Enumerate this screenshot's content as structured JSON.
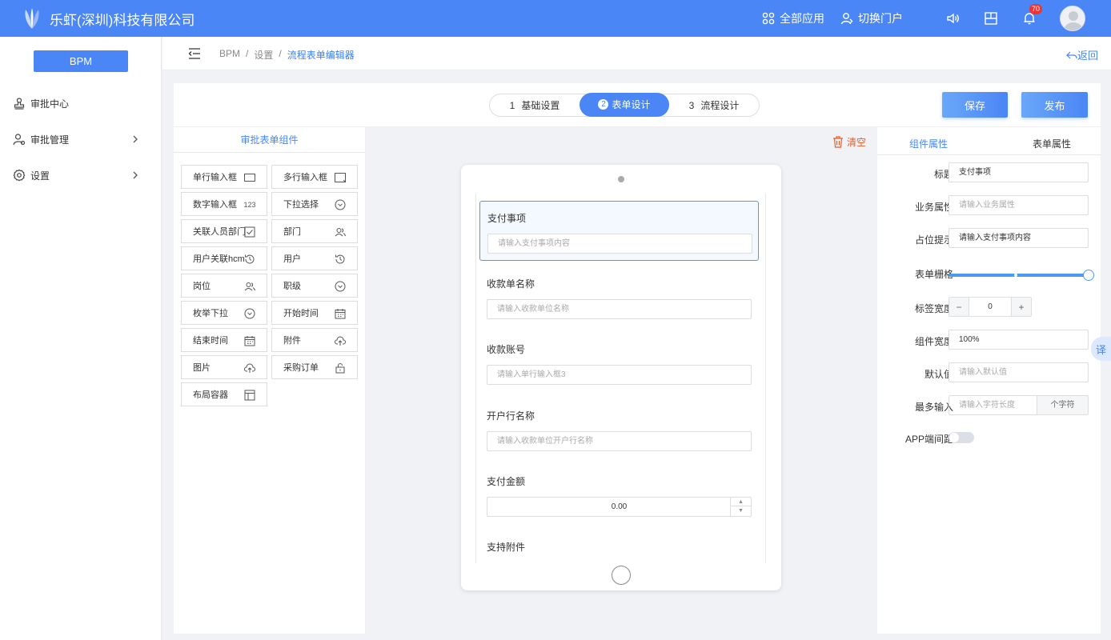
{
  "header": {
    "company": "乐虾(深圳)科技有限公司",
    "all_apps": "全部应用",
    "switch_portal": "切换门户",
    "notification_count": "70",
    "brand_color": "#4a86f5"
  },
  "sidebar": {
    "app_button": "BPM",
    "items": [
      {
        "label": "审批中心",
        "icon": "stamp-icon"
      },
      {
        "label": "审批管理",
        "icon": "user-settings-icon"
      },
      {
        "label": "设置",
        "icon": "gear-icon"
      }
    ]
  },
  "breadcrumb": {
    "items": [
      "BPM",
      "设置",
      "流程表单编辑器"
    ],
    "sep": "/",
    "back": "返回"
  },
  "steps": [
    {
      "num": "1",
      "label": "基础设置"
    },
    {
      "num": "2",
      "label": "表单设计"
    },
    {
      "num": "3",
      "label": "流程设计"
    }
  ],
  "actions": {
    "save": "保存",
    "publish": "发布"
  },
  "components_panel": {
    "title": "审批表单组件",
    "items": [
      {
        "label": "单行输入框",
        "icon": "input-icon"
      },
      {
        "label": "多行输入框",
        "icon": "textarea-icon"
      },
      {
        "label": "数字输入框",
        "icon": "number-icon",
        "glyph": "123"
      },
      {
        "label": "下拉选择",
        "icon": "chevron-circle-icon"
      },
      {
        "label": "关联人员部门",
        "icon": "checkbox-icon"
      },
      {
        "label": "部门",
        "icon": "users-icon"
      },
      {
        "label": "用户关联hcm",
        "icon": "history-icon"
      },
      {
        "label": "用户",
        "icon": "history-icon"
      },
      {
        "label": "岗位",
        "icon": "users-icon"
      },
      {
        "label": "职级",
        "icon": "chevron-circle-icon"
      },
      {
        "label": "枚举下拉",
        "icon": "chevron-circle-icon"
      },
      {
        "label": "开始时间",
        "icon": "calendar-icon"
      },
      {
        "label": "结束时间",
        "icon": "calendar-icon"
      },
      {
        "label": "附件",
        "icon": "upload-cloud-icon"
      },
      {
        "label": "图片",
        "icon": "upload-cloud-icon"
      },
      {
        "label": "采购订单",
        "icon": "lock-icon"
      },
      {
        "label": "布局容器",
        "icon": "layout-icon"
      }
    ]
  },
  "canvas": {
    "clear": "清空",
    "fields": [
      {
        "label": "支付事项",
        "placeholder": "请输入支付事项内容"
      },
      {
        "label": "收款单名称",
        "placeholder": "请输入收款单位名称"
      },
      {
        "label": "收款账号",
        "placeholder": "请输入单行输入框3"
      },
      {
        "label": "开户行名称",
        "placeholder": "请输入收款单位开户行名称"
      },
      {
        "label": "支付金额",
        "value": "0.00"
      },
      {
        "label": "支持附件"
      }
    ]
  },
  "props": {
    "tab_component": "组件属性",
    "tab_form": "表单属性",
    "title_label": "标题",
    "title_value": "支付事项",
    "biz_label": "业务属性",
    "biz_placeholder": "请输入业务属性",
    "placeholder_label": "占位提示",
    "placeholder_value": "请输入支付事项内容",
    "grid_label": "表单栅格",
    "grid_value_fraction": 1.0,
    "label_width_label": "标签宽度",
    "label_width_value": "0",
    "comp_width_label": "组件宽度",
    "comp_width_value": "100%",
    "default_label": "默认值",
    "default_placeholder": "请输入默认值",
    "maxlen_label": "最多输入",
    "maxlen_placeholder": "请输入字符长度",
    "maxlen_suffix": "个字符",
    "app_spacing_label": "APP端间距"
  },
  "translate": "译"
}
